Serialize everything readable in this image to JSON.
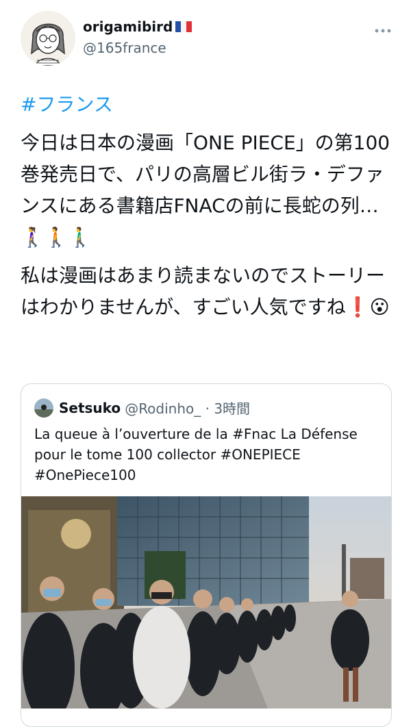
{
  "tweet": {
    "display_name": "origamibird",
    "handle": "@165france",
    "more_icon": "more-horizontal-icon",
    "hashtag": "#フランス",
    "paragraphs": [
      "今日は日本の漫画「ONE PIECE」の第100巻発売日で、パリの高層ビル街ラ・デファンスにある書籍店FNACの前に長蛇の列…🚶‍♀️🚶🚶‍♂️",
      "私は漫画はあまり読まないのでストーリーはわかりませんが、すごい人気ですね❗️😮"
    ]
  },
  "quoted": {
    "name": "Setsuko",
    "handle_time": "@Rodinho_ · 3時間",
    "text_lines": [
      "La queue à l’ouverture de la #Fnac La Défense",
      "pour le tome 100 collector #ONEPIECE",
      "#OnePiece100"
    ]
  },
  "colors": {
    "link": "#1d9bf0",
    "secondary_text": "#536471",
    "border": "#cfd9de"
  }
}
